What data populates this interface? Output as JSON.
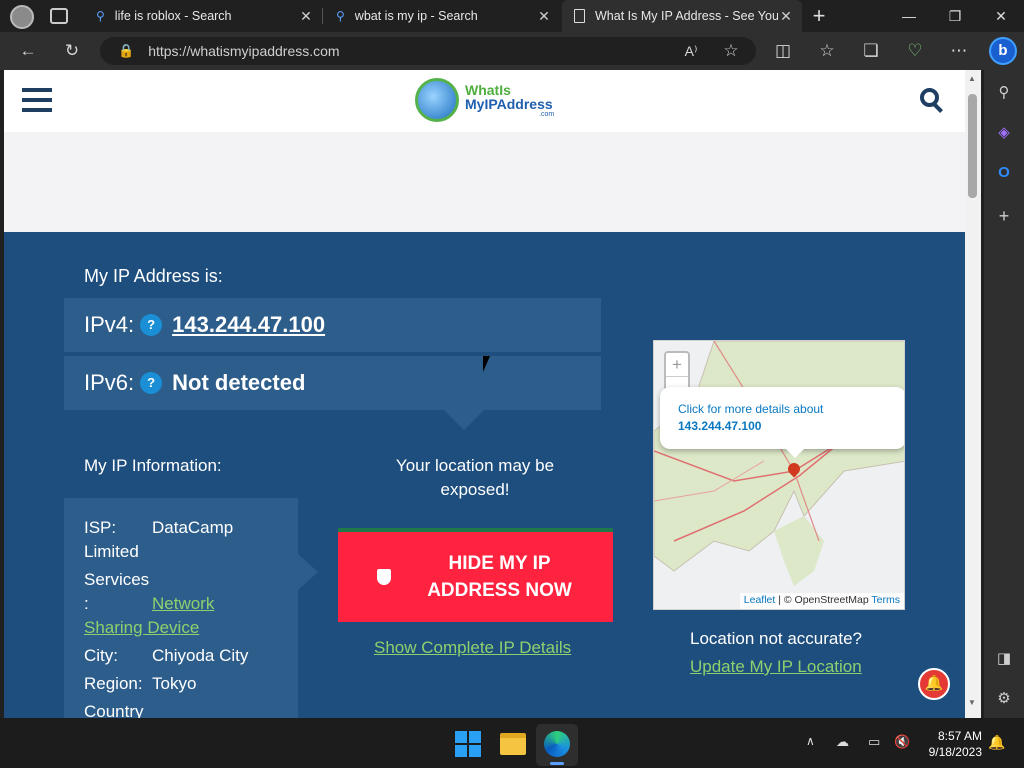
{
  "browser": {
    "tabs": [
      {
        "title": "life is roblox - Search"
      },
      {
        "title": "wbat is my ip - Search"
      },
      {
        "title": "What Is My IP Address - See You"
      }
    ],
    "address_url": "https://whatismyipaddress.com"
  },
  "site": {
    "logo_line1": "WhatIs",
    "logo_line2": "MyIPAddress",
    "logo_suffix": ".com",
    "heading_ip": "My IP Address is:",
    "ipv4_label": "IPv4:",
    "ipv4_value": "143.244.47.100",
    "ipv6_label": "IPv6:",
    "ipv6_value": "Not detected",
    "q_mark": "?",
    "heading_info": "My IP Information:",
    "info": {
      "isp_label": "ISP:",
      "isp_value": "DataCamp",
      "isp_value2": "Limited",
      "services_label": "Services",
      "services_colon": ":",
      "services_value": "Network",
      "services_value2": "Sharing Device",
      "city_label": "City:",
      "city_value": "Chiyoda City",
      "region_label": "Region:",
      "region_value": "Tokyo",
      "country_label": "Country"
    },
    "exposed_text": "Your location may be exposed!",
    "hide_button": "HIDE MY IP ADDRESS NOW",
    "show_details_link": "Show Complete IP Details",
    "map": {
      "zoom_in": "+",
      "zoom_out": "−",
      "popup_text": "Click for more details about",
      "popup_ip": "143.244.47.100",
      "attribution_leaflet": "Leaflet",
      "attribution_rest": "| © OpenStreetMap",
      "attribution_terms": "Terms"
    },
    "not_accurate": "Location not accurate?",
    "update_link": "Update My IP Location"
  },
  "taskbar": {
    "time": "8:57 AM",
    "date": "9/18/2023"
  }
}
